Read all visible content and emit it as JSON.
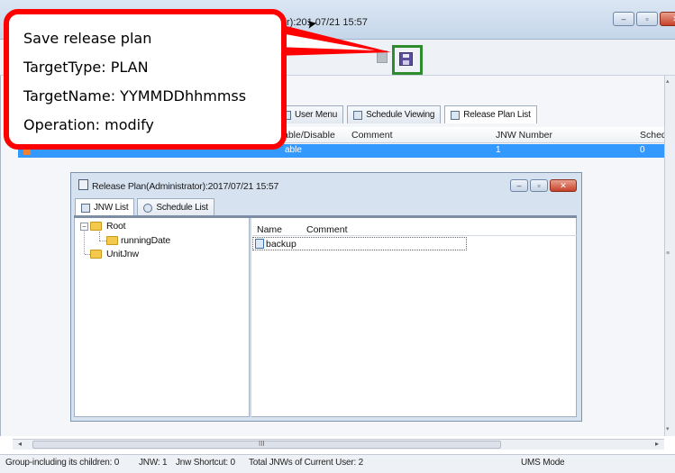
{
  "outer_window": {
    "title": "r):201 07/21 15:57",
    "buttons": {
      "minimize": "–",
      "maximize": "▫",
      "close": "✕"
    }
  },
  "callout": {
    "lines": [
      "Save release plan",
      "TargetType: PLAN",
      "TargetName: YYMMDDhhmmss",
      "Operation: modify"
    ],
    "border_color": "#ff0000"
  },
  "toolbar": {
    "save_icon": "save-icon",
    "highlight_color": "#2e8b2e"
  },
  "tabs": [
    {
      "label": "User Menu",
      "icon": "user-menu-icon",
      "active": false
    },
    {
      "label": "Schedule Viewing",
      "icon": "schedule-viewing-icon",
      "active": false
    },
    {
      "label": "Release Plan List",
      "icon": "release-plan-icon",
      "active": true
    }
  ],
  "release_list": {
    "columns": [
      "able/Disable",
      "Comment",
      "JNW Number",
      "Sched"
    ],
    "rows": [
      {
        "enable": "able",
        "comment": "",
        "jnw_number": "1",
        "sched": "0",
        "selected": true
      }
    ],
    "selection_color": "#3399ff"
  },
  "dialog": {
    "title": "Release Plan(Administrator):2017/07/21 15:57",
    "tabs": [
      {
        "label": "JNW List",
        "active": true
      },
      {
        "label": "Schedule List",
        "active": false
      }
    ],
    "tree": [
      {
        "label": "Root",
        "level": 0,
        "expanded": true
      },
      {
        "label": "runningDate",
        "level": 1
      },
      {
        "label": "UnitJnw",
        "level": 0
      }
    ],
    "list": {
      "columns": [
        "Name",
        "Comment"
      ],
      "rows": [
        {
          "name": "backup",
          "comment": ""
        }
      ]
    }
  },
  "status_bar": {
    "group_info": "Group-including its children: 0",
    "jnw": "JNW: 1",
    "jnw_shortcut": "Jnw Shortcut: 0",
    "total": "Total JNWs of Current User: 2",
    "mode": "UMS Mode"
  },
  "scrollbar": {
    "grip": "III",
    "left_arrow": "◂",
    "right_arrow": "▸",
    "up_arrow": "▴",
    "down_arrow": "▾",
    "mid_grip": "≡"
  }
}
